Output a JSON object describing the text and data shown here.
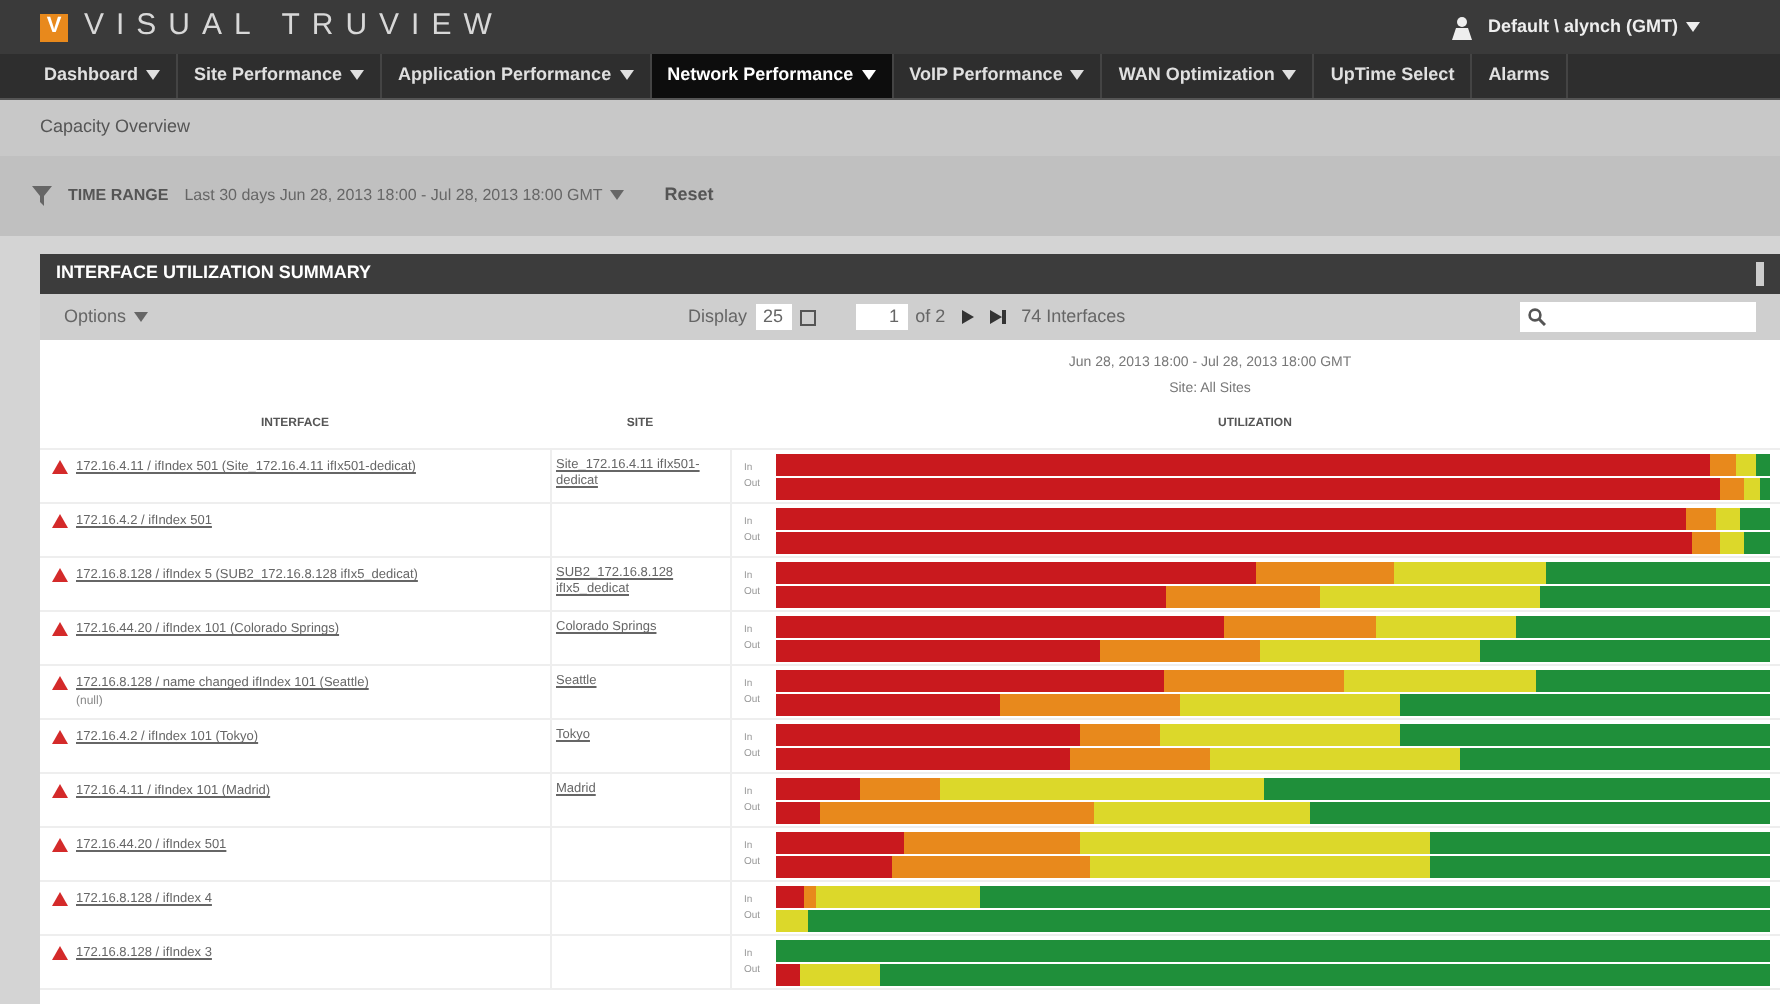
{
  "app": {
    "logo_letter": "V",
    "title": "VISUAL TRUVIEW",
    "user": "Default \\ alynch (GMT)"
  },
  "nav": [
    {
      "label": "Dashboard",
      "dropdown": true,
      "selected": false
    },
    {
      "label": "Site Performance",
      "dropdown": true,
      "selected": false
    },
    {
      "label": "Application Performance",
      "dropdown": true,
      "selected": false
    },
    {
      "label": "Network Performance",
      "dropdown": true,
      "selected": true
    },
    {
      "label": "VoIP Performance",
      "dropdown": true,
      "selected": false
    },
    {
      "label": "WAN Optimization",
      "dropdown": true,
      "selected": false
    },
    {
      "label": "UpTime Select",
      "dropdown": false,
      "selected": false
    },
    {
      "label": "Alarms",
      "dropdown": false,
      "selected": false
    }
  ],
  "breadcrumb": "Capacity Overview",
  "time_range": {
    "label": "TIME RANGE",
    "value": "Last 30 days Jun 28, 2013 18:00 - Jul 28, 2013 18:00 GMT",
    "reset": "Reset"
  },
  "panel": {
    "title": "INTERFACE UTILIZATION SUMMARY",
    "options": "Options",
    "display_label": "Display",
    "page_size": "25",
    "page": "1",
    "page_of": "of 2",
    "count": "74 Interfaces",
    "date_line": "Jun 28, 2013 18:00 - Jul 28, 2013 18:00 GMT",
    "site_line": "Site: All Sites",
    "columns": [
      "INTERFACE",
      "SITE",
      "UTILIZATION"
    ],
    "rows": [
      {
        "interface": "172.16.4.11 / ifIndex 501 (Site_172.16.4.11 ifIx501-dedicat)",
        "site": "Site_172.16.4.11 ifIx501-dedicat",
        "in": "In",
        "out": "Out"
      },
      {
        "interface": "172.16.4.2 / ifIndex 501",
        "in": "In",
        "out": "Out"
      },
      {
        "interface": "172.16.8.128 / ifIndex 5 (SUB2_172.16.8.128 ifIx5_dedicat)",
        "site": "SUB2_172.16.8.128 ifIx5_dedicat",
        "in": "In",
        "out": "Out"
      },
      {
        "interface": "172.16.44.20 / ifIndex 101 (Colorado Springs)",
        "site": "Colorado Springs",
        "in": "In",
        "out": "Out"
      },
      {
        "interface": "172.16.8.128 / name changed ifIndex 101 (Seattle)",
        "note": "(null)",
        "site": "Seattle",
        "in": "In",
        "out": "Out"
      },
      {
        "interface": "172.16.4.2 / ifIndex 101 (Tokyo)",
        "site": "Tokyo",
        "in": "In",
        "out": "Out"
      },
      {
        "interface": "172.16.4.11 / ifIndex 101 (Madrid)",
        "site": "Madrid",
        "in": "In",
        "out": "Out"
      },
      {
        "interface": "172.16.44.20 / ifIndex 501",
        "in": "In",
        "out": "Out"
      },
      {
        "interface": "172.16.8.128 / ifIndex 4",
        "in": "In",
        "out": "Out"
      },
      {
        "interface": "172.16.8.128 / ifIndex 3",
        "in": "In",
        "out": "Out"
      }
    ]
  }
}
